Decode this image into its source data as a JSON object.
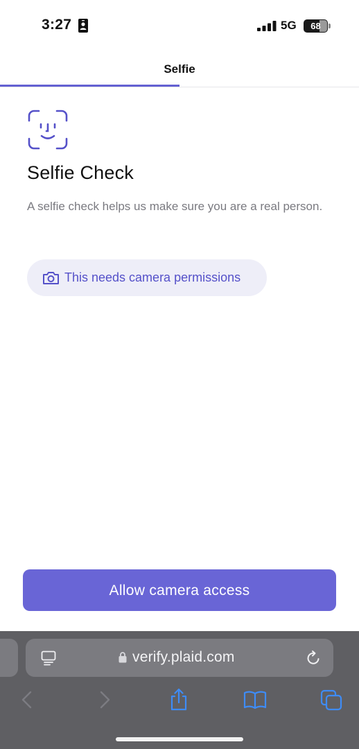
{
  "status_bar": {
    "time": "3:27",
    "network": "5G",
    "battery": "68",
    "battery_level": 0.68
  },
  "header": {
    "title": "Selfie",
    "progress": 0.5
  },
  "content": {
    "icon": "face-scan-icon",
    "title": "Selfie Check",
    "description": "A selfie check helps us make sure you are a real person.",
    "permission_notice": {
      "icon": "camera-icon",
      "text": "This needs camera permissions"
    }
  },
  "actions": {
    "primary_label": "Allow camera access"
  },
  "browser": {
    "url": "verify.plaid.com",
    "icons": [
      "reader-icon",
      "lock-icon",
      "reload-icon",
      "back-icon",
      "forward-icon",
      "share-icon",
      "bookmarks-icon",
      "tabs-icon"
    ]
  },
  "colors": {
    "accent": "#6965d6",
    "accent_text": "#5551c9",
    "pill_bg": "#eeeef8",
    "browser_bg": "#5f5f63",
    "link_blue": "#3e8cf7"
  }
}
